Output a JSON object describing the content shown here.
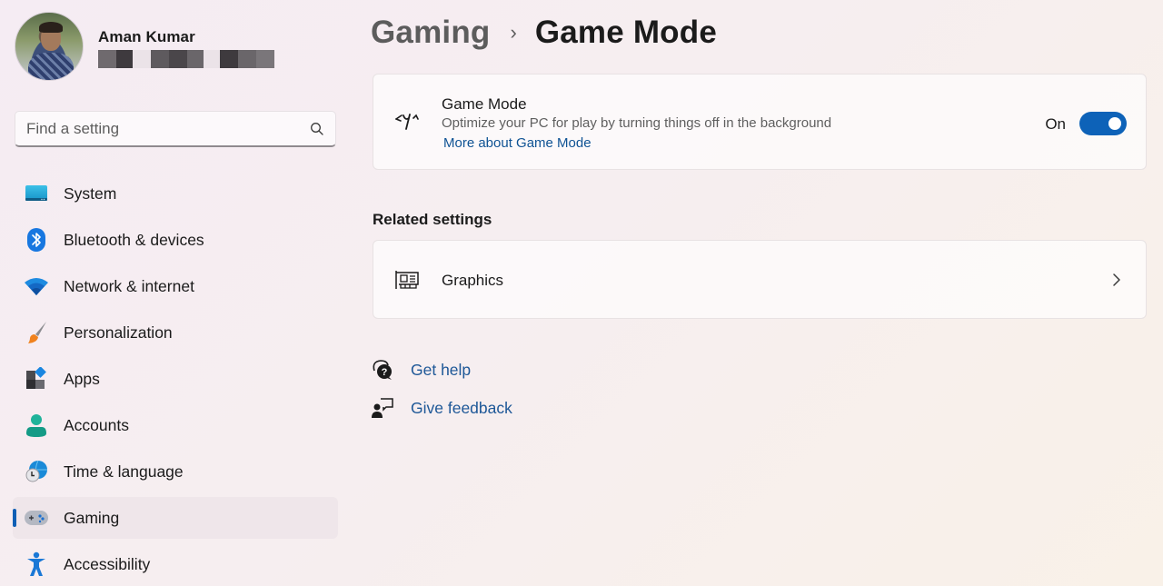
{
  "profile": {
    "name": "Aman Kumar",
    "email_redacted": true
  },
  "search": {
    "placeholder": "Find a setting",
    "value": ""
  },
  "sidebar": {
    "items": [
      {
        "label": "System",
        "icon": "system-icon",
        "active": false
      },
      {
        "label": "Bluetooth & devices",
        "icon": "bluetooth-icon",
        "active": false
      },
      {
        "label": "Network & internet",
        "icon": "wifi-icon",
        "active": false
      },
      {
        "label": "Personalization",
        "icon": "paintbrush-icon",
        "active": false
      },
      {
        "label": "Apps",
        "icon": "apps-icon",
        "active": false
      },
      {
        "label": "Accounts",
        "icon": "person-icon",
        "active": false
      },
      {
        "label": "Time & language",
        "icon": "globe-clock-icon",
        "active": false
      },
      {
        "label": "Gaming",
        "icon": "gamepad-icon",
        "active": true
      },
      {
        "label": "Accessibility",
        "icon": "accessibility-icon",
        "active": false
      }
    ]
  },
  "breadcrumb": {
    "parent": "Gaming",
    "separator": "›",
    "current": "Game Mode"
  },
  "game_mode": {
    "title": "Game Mode",
    "description": "Optimize your PC for play by turning things off in the background",
    "link": "More about Game Mode",
    "state_label": "On",
    "enabled": true
  },
  "related": {
    "title": "Related settings",
    "items": [
      {
        "label": "Graphics",
        "icon": "graphics-card-icon"
      }
    ]
  },
  "help": {
    "get_help": "Get help",
    "give_feedback": "Give feedback"
  },
  "colors": {
    "accent": "#0d62b8",
    "link": "#0f5394",
    "active_nav_bg": "#efe6ea"
  }
}
